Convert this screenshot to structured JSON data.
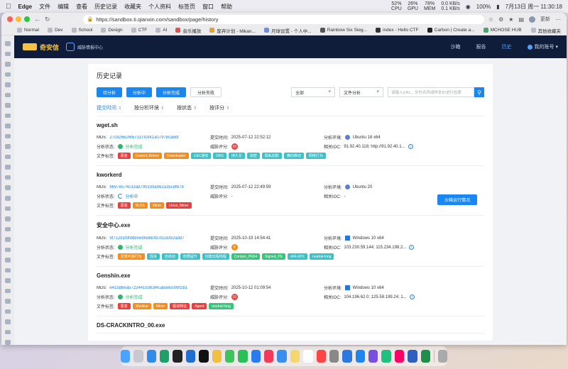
{
  "menubar": {
    "app": "Edge",
    "items": [
      "文件",
      "编辑",
      "查看",
      "历史记录",
      "收藏夹",
      "个人资料",
      "标签页",
      "窗口",
      "帮助"
    ],
    "stats": [
      [
        "52%",
        "CPU"
      ],
      [
        "26%",
        "GPU"
      ],
      [
        "78%",
        "MEM"
      ],
      [
        "0.0 KB/s",
        "0.1 KB/s"
      ]
    ],
    "battery": "100%",
    "datetime": "7月13日 周一 11:30:18"
  },
  "browser": {
    "url": "https://sandbox.ti.qianxin.com/sandbox/page/history",
    "update_label": "更新",
    "bookmarks": [
      "Normal",
      "Dev",
      "School",
      "Design",
      "CTF",
      "AI",
      "音乐播放",
      "废弃计划 - Mikan...",
      "月球设置 - 个人中...",
      "Rainbow Six Sieg...",
      "index - Hello CTF",
      "Carbon | Create a...",
      "MCHOSE HUB"
    ],
    "other_bookmarks": "其他收藏夹"
  },
  "nav": {
    "brand": "奇安信",
    "subbrand": "威胁情报中心",
    "links": [
      "沙箱",
      "报告",
      "历史",
      "我的账号 ▾"
    ],
    "active_index": 2
  },
  "page": {
    "heading": "历史记录",
    "filter_buttons": [
      "待分析",
      "分析中",
      "分析完成",
      "分析失败"
    ],
    "select_all": "全部",
    "select_file": "文件分析",
    "search_placeholder": "请输入URL、文件名称或样本ID进行检索",
    "sorts": [
      "提交时间",
      "按分析环境",
      "按状态",
      "按评分"
    ],
    "labels": {
      "md5": "MD5:",
      "status": "分析状态:",
      "tags": "文件标签:",
      "submit_time": "提交时间:",
      "threat_score": "威胁评分:",
      "env": "分析环境:",
      "ioc": "相关IOC:"
    },
    "report_button": "沙箱运行情况"
  },
  "records": [
    {
      "name": "wget.sh",
      "md5": "27c926626f67337fc941a07978ca6bf",
      "status": "分析完成",
      "status_type": "ok",
      "submit_time": "2025-07-12 22:52:12",
      "score": "10",
      "score_color": "#e8403f",
      "env": "Ubuntu 18 x64",
      "env_icon": "ubuntu",
      "ioc": "91.92.40.118; http://91.92.40.1...",
      "show_info": true,
      "tags": [
        {
          "text": "恶意",
          "color": "red"
        },
        {
          "text": "Generic.Botnet",
          "color": "orange"
        },
        {
          "text": "Downloader",
          "color": "orange"
        },
        {
          "text": "C&C通信",
          "color": "teal"
        },
        {
          "text": "DNS",
          "color": "teal"
        },
        {
          "text": "持久化",
          "color": "teal"
        },
        {
          "text": "加密",
          "color": "teal"
        },
        {
          "text": "隐私窃取",
          "color": "teal"
        },
        {
          "text": "横向移动",
          "color": "teal"
        },
        {
          "text": "网络行为",
          "color": "teal"
        }
      ]
    },
    {
      "name": "kworkerd",
      "md5": "6697e574c33a8790339a962a35cdfb78",
      "status": "分析中",
      "status_type": "run",
      "submit_time": "2025-07-12 22:49:59",
      "score": "-",
      "score_color": "",
      "env": "Ubuntu 20",
      "env_icon": "ubuntu",
      "ioc": "-",
      "show_info": false,
      "report": true,
      "tags": [
        {
          "text": "恶意",
          "color": "red"
        },
        {
          "text": "BLDS",
          "color": "orange"
        },
        {
          "text": "Miner",
          "color": "orange"
        },
        {
          "text": "Linux_Miner",
          "color": "red"
        }
      ]
    },
    {
      "name": "安全中心.exe",
      "md5": "9f712b1f9fddb0e8fe880fd7b1d392add7",
      "status": "分析完成",
      "status_type": "ok",
      "submit_time": "2025-10-19 14:54:41",
      "score": "8",
      "score_color": "#f38e1e",
      "env": "Windows 10 x64",
      "env_icon": "windows",
      "ioc": "103.230.59.144; 115.234.198.2...",
      "show_info": true,
      "tags": [
        {
          "text": "发现可疑行为",
          "color": "orange"
        },
        {
          "text": "混淆",
          "color": "teal"
        },
        {
          "text": "自启动",
          "color": "teal"
        },
        {
          "text": "权限提升",
          "color": "teal"
        },
        {
          "text": "创建远程线程",
          "color": "teal"
        },
        {
          "text": "Contain_PE64",
          "color": "green"
        },
        {
          "text": "Signed_PE",
          "color": "green"
        },
        {
          "text": "x64-UPX",
          "color": "teal"
        },
        {
          "text": "neutral-long",
          "color": "teal"
        }
      ]
    },
    {
      "name": "Genshin.exe",
      "md5": "e41dd8ea57224419363f4ca8ae5099f2b1",
      "status": "分析完成",
      "status_type": "ok",
      "submit_time": "2025-10-12 01:09:54",
      "score": "10",
      "score_color": "#e8403f",
      "env": "Windows 10 x64",
      "env_icon": "windows",
      "ioc": "104.196.62.0; 125.58.199.24; 1...",
      "show_info": true,
      "tags": [
        {
          "text": "恶意",
          "color": "red"
        },
        {
          "text": "Shellme",
          "color": "orange"
        },
        {
          "text": "Miner",
          "color": "orange"
        },
        {
          "text": "驱动特征",
          "color": "red"
        },
        {
          "text": "Agent",
          "color": "red"
        },
        {
          "text": "neutral-long",
          "color": "green"
        }
      ]
    },
    {
      "name": "DS-CRACKINTRO_00.exe",
      "partial": true
    }
  ],
  "dock": {
    "apps": [
      "finder",
      "launchpad",
      "safari",
      "edge",
      "terminal",
      "vscode",
      "chatgpt",
      "photos",
      "messages",
      "wechat",
      "qq",
      "music",
      "mail",
      "notes",
      "reminders",
      "calendar",
      "settings",
      "xcode",
      "app-store",
      "vs",
      "pycharm",
      "figma",
      "word",
      "excel",
      "trash"
    ]
  }
}
